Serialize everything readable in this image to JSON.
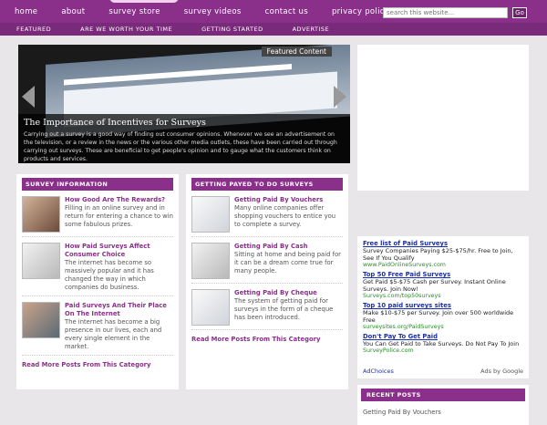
{
  "nav": {
    "items": [
      "home",
      "about",
      "survey store",
      "survey videos",
      "contact us",
      "privacy policy"
    ],
    "search_placeholder": "search this website...",
    "go_label": "Go"
  },
  "subnav": [
    "FEATURED",
    "ARE WE WORTH YOUR TIME",
    "GETTING STARTED",
    "ADVERTISE"
  ],
  "featured": {
    "badge": "Featured Content",
    "title": "The Importance of Incentives for Surveys",
    "text": "Carrying out a survey is a good way of finding out consumer opinions. Whenever we see an advertisement on the television, or a review in the news or the various other media outlets, these have been carried out through carrying out surveys. These are beneficial to get people's opinion and to gauge what the customers think on products and services."
  },
  "col1": {
    "heading": "SURVEY INFORMATION",
    "posts": [
      {
        "title": "How Good Are The Rewards?",
        "text": "Filling in an online survey and in return for entering a chance to win some fabulous prizes."
      },
      {
        "title": "How Paid Surveys Affect Consumer Choice",
        "text": "The internet has become so massively popular and it has changed the way in which companies do business."
      },
      {
        "title": "Paid Surveys And Their Place On The Internet",
        "text": "The internet has become a big presence in our lives, each and every single element in the market."
      }
    ],
    "more": "Read More Posts From This Category"
  },
  "col2": {
    "heading": "GETTING PAYED TO DO SURVEYS",
    "posts": [
      {
        "title": "Getting Paid By Vouchers",
        "text": "Many online companies offer shopping vouchers to entice you to complete a survey."
      },
      {
        "title": "Getting Paid By Cash",
        "text": "Sitting at home and being paid for it can be a dream come true for many people."
      },
      {
        "title": "Getting Paid By Cheque",
        "text": "The system of getting paid for surveys in the form of a cheque has been introduced."
      }
    ],
    "more": "Read More Posts From This Category"
  },
  "ads": {
    "items": [
      {
        "title": "Free list of Paid Surveys",
        "text": "Survey Companies Paying $25-$75/hr. Free to Join, See If You Qualify",
        "url": "www.PaidOnlineSurveys.com"
      },
      {
        "title": "Top 50 Free Paid Surveys",
        "text": "Get Paid $5-$75 Cash per Survey. Instant Online Surveys. Join Now!",
        "url": "Surveys.com/top50surveys"
      },
      {
        "title": "Top 10 paid surveys sites",
        "text": "Make $10-$75 per Survey. Join over 500 worldwide Free",
        "url": "surveysites.org/PaidSurveys"
      },
      {
        "title": "Don't Pay To Get Paid",
        "text": "You Can Get Paid to Take Surveys. Do Not Pay To Join",
        "url": "SurveyPolice.com"
      }
    ],
    "adchoices": "AdChoices",
    "adsby": "Ads by Google"
  },
  "recent": {
    "heading": "RECENT POSTS",
    "first_item": "Getting Paid By Vouchers"
  }
}
